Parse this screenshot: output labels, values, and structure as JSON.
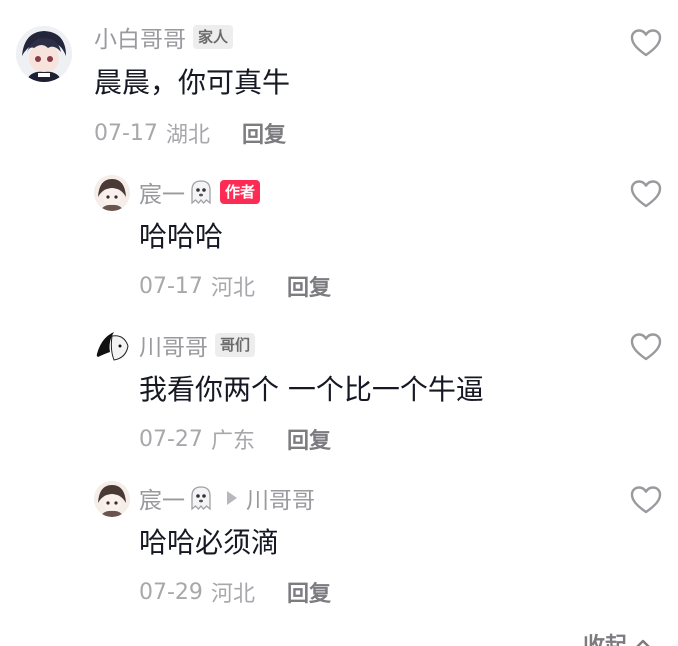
{
  "comments": [
    {
      "username": "小白哥哥",
      "badge": "家人",
      "text": "晨晨，你可真牛",
      "date": "07-17",
      "location": "湖北",
      "reply_label": "回复"
    },
    {
      "username": "宸一",
      "badge": "作者",
      "text": "哈哈哈",
      "date": "07-17",
      "location": "河北",
      "reply_label": "回复"
    },
    {
      "username": "川哥哥",
      "badge": "哥们",
      "text": "我看你两个 一个比一个牛逼",
      "date": "07-27",
      "location": "广东",
      "reply_label": "回复"
    },
    {
      "username": "宸一",
      "reply_to": "川哥哥",
      "text": "哈哈必须滴",
      "date": "07-29",
      "location": "河北",
      "reply_label": "回复"
    }
  ],
  "collapse_label": "收起",
  "colors": {
    "author_badge": "#fe2c55",
    "username": "#9a9a9e",
    "text": "#161823"
  }
}
